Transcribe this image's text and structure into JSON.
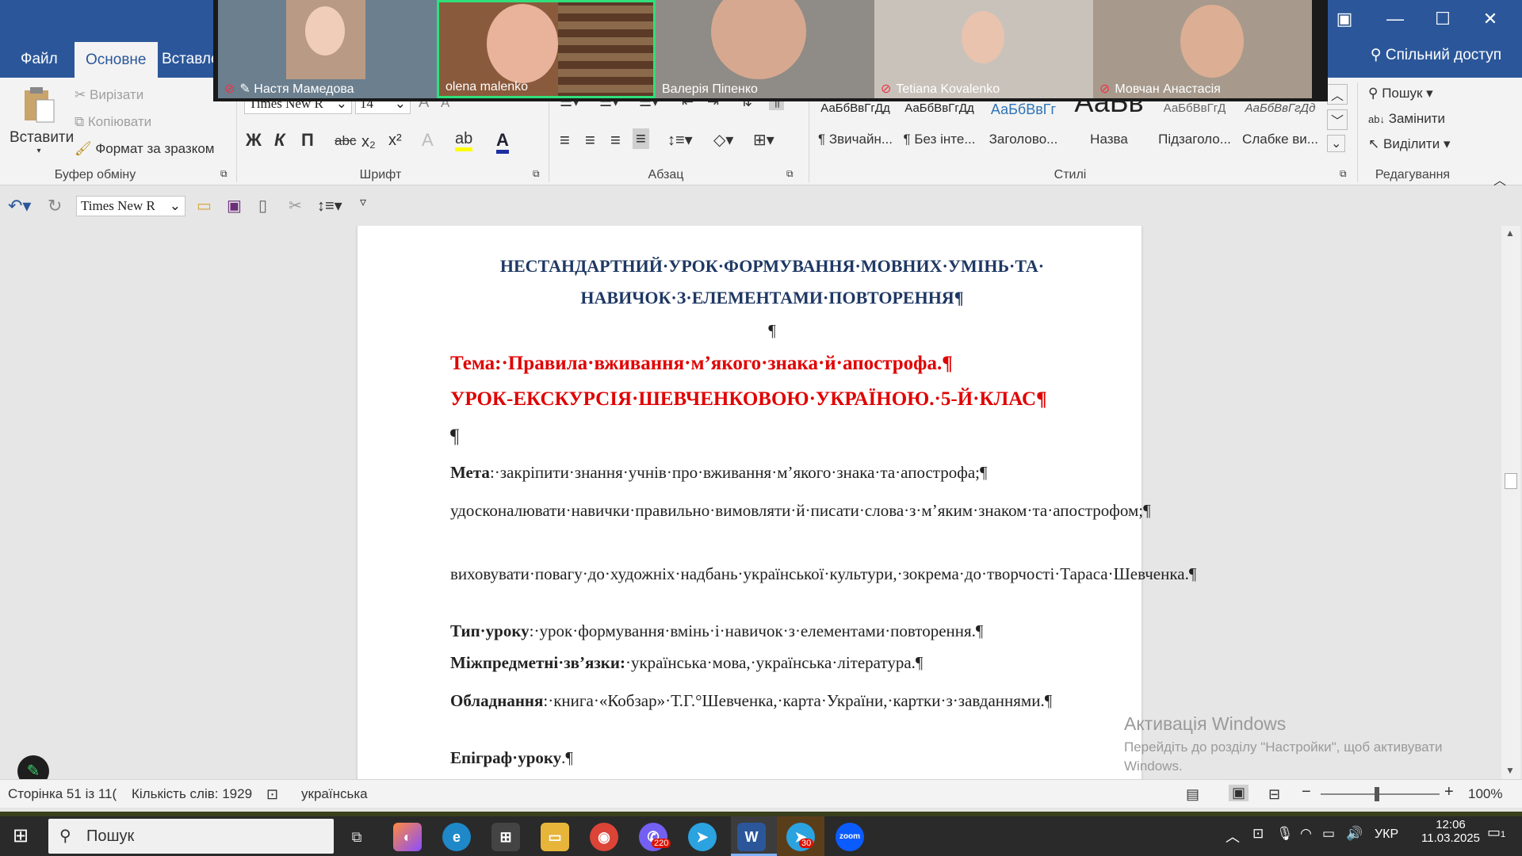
{
  "ribbon_tabs": [
    "Файл",
    "Основне",
    "Вставлення"
  ],
  "share_label": "Спільний доступ",
  "clipboard": {
    "paste": "Вставити",
    "cut": "Вирізати",
    "copy": "Копіювати",
    "format_painter": "Формат за зразком",
    "group": "Буфер обміну"
  },
  "font": {
    "family": "Times New R",
    "size": "14",
    "bold": "Ж",
    "italic": "К",
    "underline": "П",
    "strike": "abc",
    "subscript": "x₂",
    "superscript": "x²",
    "group": "Шрифт"
  },
  "paragraph": {
    "group": "Абзац"
  },
  "styles": {
    "group": "Стилі",
    "items": [
      {
        "preview": "АаБбВвГгДд",
        "name": "¶ Звичайн..."
      },
      {
        "preview": "АаБбВвГгДд",
        "name": "¶ Без інте..."
      },
      {
        "preview": "АаБбВвГг",
        "name": "Заголово..."
      },
      {
        "preview": "АаБв",
        "name": "Назва"
      },
      {
        "preview": "АаБбВвГгД",
        "name": "Підзаголо..."
      },
      {
        "preview": "АаБбВвГгДд",
        "name": "Слабке ви..."
      }
    ]
  },
  "editing": {
    "find": "Пошук",
    "replace": "Замінити",
    "select": "Виділити",
    "group": "Редагування"
  },
  "qat": {
    "font": "Times New R"
  },
  "document": {
    "heading_line1": "НЕСТАНДАРТНИЙ·УРОК·ФОРМУВАННЯ·МОВНИХ·УМІНЬ·ТА·",
    "heading_line2": "НАВИЧОК·З·ЕЛЕМЕНТАМИ·ПОВТОРЕННЯ¶",
    "pilcrow": "¶",
    "topic": "Тема:·Правила·вживання·м’якого·знака·й·апострофа.¶",
    "lesson": "УРОК-ЕКСКУРСІЯ·ШЕВЧЕНКОВОЮ·УКРАЇНОЮ.·5-Й·КЛАС¶",
    "goal_label": "Мета",
    "goal_text": ":·закріпити·знання·учнів·про·вживання·м’якого·знака·та·апострофа;¶",
    "goal_line2": "удосконалювати·навички·правильно·вимовляти·й·писати·слова·з·м’яким·знаком·та·апострофом;¶",
    "goal_line3": "виховувати·повагу·до·художніх·надбань·української·культури,·зокрема·до·творчості·Тараса·Шевченка.¶",
    "type_label": "Тип·уроку",
    "type_text": ":·урок·формування·вмінь·і·навичок·з·елементами·повторення.¶",
    "inter_label": "Міжпредметні·зв’язки:",
    "inter_text": "·українська·мова,·українська·література.¶",
    "equip_label": "Обладнання",
    "equip_text": ":·книга·«Кобзар»·Т.Г.°Шевченка,·карта·України,·картки·з·завданнями.¶",
    "epigraph_label": "Епіграф·уроку",
    "epigraph_text": ".¶"
  },
  "status": {
    "page": "Сторінка 51 із 11(",
    "words": "Кількість слів: 1929",
    "language": "українська",
    "zoom": "100%"
  },
  "watermark": {
    "title": "Активація Windows",
    "line": "Перейдіть до розділу \"Настройки\", щоб активувати Windows."
  },
  "taskbar": {
    "search": "Пошук",
    "badge_viber": "220",
    "badge_telegram": "30",
    "lang": "УКР",
    "time": "12:06",
    "date": "11.03.2025",
    "notif": "1"
  },
  "zoom_participants": [
    {
      "name": "Настя Мамедова",
      "muted": true
    },
    {
      "name": "olena malenko",
      "muted": false
    },
    {
      "name": "Валерія Піпенко",
      "muted": false
    },
    {
      "name": "Tetiana Kovalenko",
      "muted": true
    },
    {
      "name": "Мовчан Анастасія",
      "muted": true
    }
  ],
  "colors": {
    "word_blue": "#2b579a",
    "heading_navy": "#1f3864",
    "red_text": "#e00000",
    "zoom_active_border": "#2fe07a"
  }
}
